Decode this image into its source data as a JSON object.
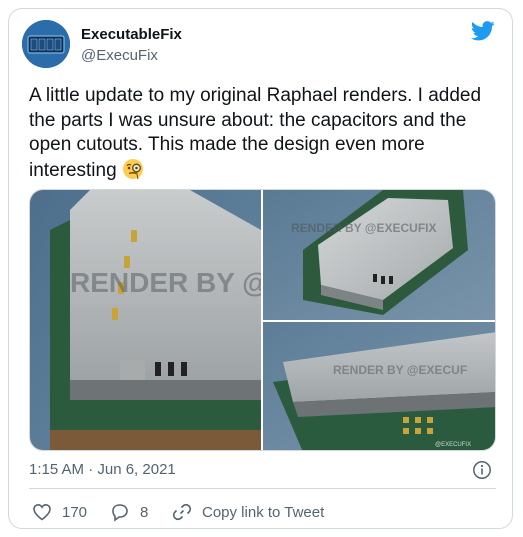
{
  "author": {
    "display_name": "ExecutableFix",
    "handle": "@ExecuFix"
  },
  "tweet": {
    "text": "A little update to my original Raphael renders. I added the parts I was unsure about: the capacitors and the open cutouts. This made the design even more interesting",
    "emoji": "face-with-monocle",
    "timestamp": "1:15 AM · Jun 6, 2021"
  },
  "media": {
    "watermark_main": "RENDER BY @",
    "watermark_tr": "RENDER BY @EXECUFIX",
    "watermark_br": "RENDER BY @EXECUF",
    "corner_label": "@EXECUFIX"
  },
  "actions": {
    "like_count": "170",
    "reply_count": "8",
    "copy_label": "Copy link to Tweet"
  },
  "colors": {
    "twitter_blue": "#1d9bf0",
    "secondary_text": "#536471",
    "border": "#cfd9de"
  },
  "icons": [
    "twitter-bird-icon",
    "info-icon",
    "heart-icon",
    "reply-icon",
    "link-icon",
    "face-with-monocle-emoji"
  ]
}
